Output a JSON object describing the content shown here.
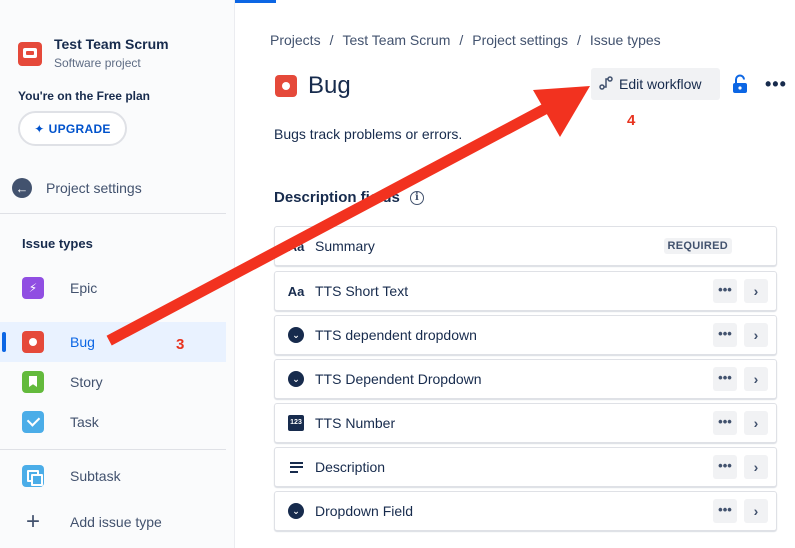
{
  "project": {
    "name": "Test Team Scrum",
    "type": "Software project"
  },
  "plan": {
    "notice": "You're on the Free plan",
    "upgrade_label": "UPGRADE"
  },
  "sidebar": {
    "back_label": "Project settings",
    "section_title": "Issue types",
    "items": [
      {
        "label": "Epic",
        "icon": "epic-icon"
      },
      {
        "label": "Bug",
        "icon": "bug-icon",
        "active": true
      },
      {
        "label": "Story",
        "icon": "story-icon"
      },
      {
        "label": "Task",
        "icon": "task-icon"
      },
      {
        "label": "Subtask",
        "icon": "subtask-icon"
      }
    ],
    "add_label": "Add issue type"
  },
  "breadcrumb": [
    "Projects",
    "Test Team Scrum",
    "Project settings",
    "Issue types"
  ],
  "page": {
    "title": "Bug",
    "description": "Bugs track problems or errors.",
    "edit_workflow_label": "Edit workflow"
  },
  "fields": {
    "heading": "Description fields",
    "rows": [
      {
        "label": "Summary",
        "icon": "text-icon",
        "icon_glyph": "Aa",
        "badge": "REQUIRED"
      },
      {
        "label": "TTS Short Text",
        "icon": "text-icon",
        "icon_glyph": "Aa"
      },
      {
        "label": "TTS dependent dropdown",
        "icon": "dropdown-icon"
      },
      {
        "label": "TTS Dependent Dropdown",
        "icon": "dropdown-icon"
      },
      {
        "label": "TTS Number",
        "icon": "number-icon",
        "icon_glyph": "123"
      },
      {
        "label": "Description",
        "icon": "paragraph-icon"
      },
      {
        "label": "Dropdown Field",
        "icon": "dropdown-icon"
      }
    ]
  },
  "annotations": {
    "step_a": "3",
    "step_b": "4",
    "color": "#e8331f"
  },
  "colors": {
    "accent": "#0c66e4",
    "bug": "#e5493a",
    "epic": "#904ee2",
    "story": "#63ba3c",
    "task": "#4bade8"
  }
}
